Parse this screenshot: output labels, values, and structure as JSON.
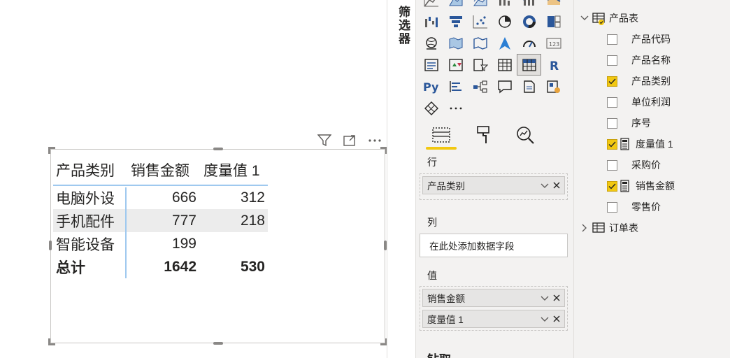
{
  "canvas": {
    "matrix": {
      "headers": [
        "产品类别",
        "销售金额",
        "度量值 1"
      ],
      "rows": [
        {
          "category": "电脑外设",
          "sales": "666",
          "measure": "312"
        },
        {
          "category": "手机配件",
          "sales": "777",
          "measure": "218"
        },
        {
          "category": "智能设备",
          "sales": "199",
          "measure": ""
        }
      ],
      "total": {
        "label": "总计",
        "sales": "1642",
        "measure": "530"
      }
    },
    "header_icons": [
      "filter-icon",
      "focus-mode-icon",
      "more-options-icon"
    ]
  },
  "filters_tab": {
    "label": "筛选器"
  },
  "visualizations": {
    "tabs": [
      "fields-tab",
      "format-tab",
      "analytics-tab"
    ],
    "rows_well": {
      "label": "行",
      "fields": [
        "产品类别"
      ]
    },
    "columns_well": {
      "label": "列",
      "placeholder": "在此处添加数据字段"
    },
    "values_well": {
      "label": "值",
      "fields": [
        "销售金额",
        "度量值 1"
      ]
    },
    "next_section": "钻取"
  },
  "fields": {
    "tables": [
      {
        "name": "产品表",
        "expanded": true,
        "fields": [
          {
            "name": "产品代码",
            "checked": false,
            "measure": false
          },
          {
            "name": "产品名称",
            "checked": false,
            "measure": false
          },
          {
            "name": "产品类别",
            "checked": true,
            "measure": false
          },
          {
            "name": "单位利润",
            "checked": false,
            "measure": false
          },
          {
            "name": "序号",
            "checked": false,
            "measure": false
          },
          {
            "name": "度量值 1",
            "checked": true,
            "measure": true
          },
          {
            "name": "采购价",
            "checked": false,
            "measure": false
          },
          {
            "name": "销售金额",
            "checked": true,
            "measure": true
          },
          {
            "name": "零售价",
            "checked": false,
            "measure": false
          }
        ]
      },
      {
        "name": "订单表",
        "expanded": false
      }
    ]
  },
  "colors": {
    "accent": "#f2c811",
    "grid_line": "#9fc9ef",
    "pane_bg": "#f3f2f1"
  }
}
